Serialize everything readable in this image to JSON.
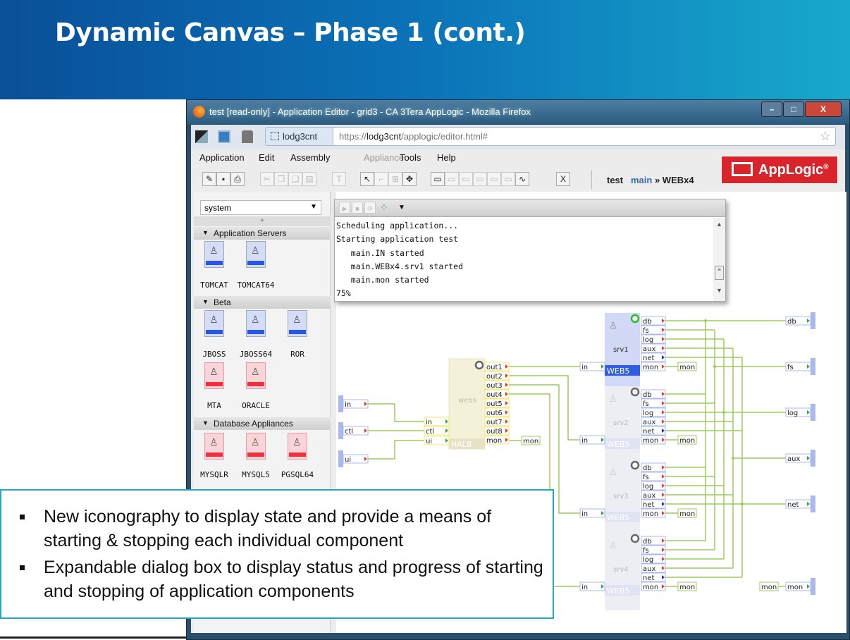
{
  "slide": {
    "title": "Dynamic Canvas – Phase 1 (cont.)",
    "bullets": [
      "New iconography to display state and provide a means of starting & stopping each individual component",
      "Expandable dialog box to display status and progress of starting and stopping of application components"
    ]
  },
  "window": {
    "title": "test [read-only] - Application Editor - grid3 - CA 3Tera AppLogic - Mozilla Firefox",
    "buttons": [
      "–",
      "□",
      "X"
    ]
  },
  "navbar": {
    "site": "lodg3cnt",
    "url_prefix": "https://",
    "url_host": "lodg3cnt",
    "url_path": "/applogic/editor.html#"
  },
  "menu": [
    {
      "label": "Application",
      "enabled": true
    },
    {
      "label": "Edit",
      "enabled": true
    },
    {
      "label": "Assembly",
      "enabled": true
    },
    {
      "label": "Appliance",
      "enabled": false
    },
    {
      "label": "Tools",
      "enabled": true
    },
    {
      "label": "Help",
      "enabled": true
    }
  ],
  "toolbar": {
    "close_label": "X",
    "breadcrumb": {
      "app": "test",
      "main": "main",
      "sep": "»",
      "current": "WEBx4"
    }
  },
  "logo": {
    "text": "AppLogic",
    "mark": "®",
    "color": "#d9242b"
  },
  "palette": {
    "catalog": "system",
    "sections": [
      {
        "title": "Application Servers",
        "items": [
          {
            "label": "TOMCAT",
            "kind": "blue"
          },
          {
            "label": "TOMCAT64",
            "kind": "blue"
          }
        ]
      },
      {
        "title": "Beta",
        "items": [
          {
            "label": "JBOSS",
            "kind": "blue"
          },
          {
            "label": "JBOSS64",
            "kind": "blue"
          },
          {
            "label": "ROR",
            "kind": "blue"
          },
          {
            "label": "MTA",
            "kind": "red"
          },
          {
            "label": "ORACLE",
            "kind": "red"
          }
        ]
      },
      {
        "title": "Database Appliances",
        "items": [
          {
            "label": "MYSQLR",
            "kind": "red"
          },
          {
            "label": "MYSQL5",
            "kind": "red"
          },
          {
            "label": "PGSQL64",
            "kind": "red"
          }
        ]
      }
    ]
  },
  "log": {
    "lines": [
      "Scheduling application...",
      "Starting application test",
      "   main.IN started",
      "   main.WEBx4.srv1 started",
      "   main.mon started",
      "75%"
    ]
  },
  "diagram": {
    "inputs": [
      "in",
      "ctl",
      "ui"
    ],
    "halb": {
      "name": "webs",
      "class": "HALB",
      "in_ports": [
        "in",
        "ctl",
        "ui"
      ],
      "out_ports": [
        "out1",
        "out2",
        "out3",
        "out4",
        "out5",
        "out6",
        "out7",
        "out8",
        "mon"
      ],
      "mon": "mon",
      "state": "paused"
    },
    "servers": [
      {
        "name": "srv1",
        "class": "WEB5",
        "state": "running",
        "in": "in",
        "mon": "mon"
      },
      {
        "name": "srv2",
        "class": "WEB5",
        "state": "stopped",
        "in": "in",
        "mon": "mon"
      },
      {
        "name": "srv3",
        "class": "WEB5",
        "state": "stopped",
        "in": "in",
        "mon": "mon"
      },
      {
        "name": "srv4",
        "class": "WEB5",
        "state": "stopped",
        "in": "in",
        "mon": "mon"
      }
    ],
    "server_ports": [
      "db",
      "fs",
      "log",
      "aux",
      "net",
      "mon"
    ],
    "outputs": [
      "db",
      "fs",
      "log",
      "aux",
      "net",
      "mon"
    ],
    "mon_out_label": "mon",
    "colors": {
      "wire": "#9acd5a",
      "running": "#22c02a",
      "active": "#2f5ee0"
    }
  }
}
